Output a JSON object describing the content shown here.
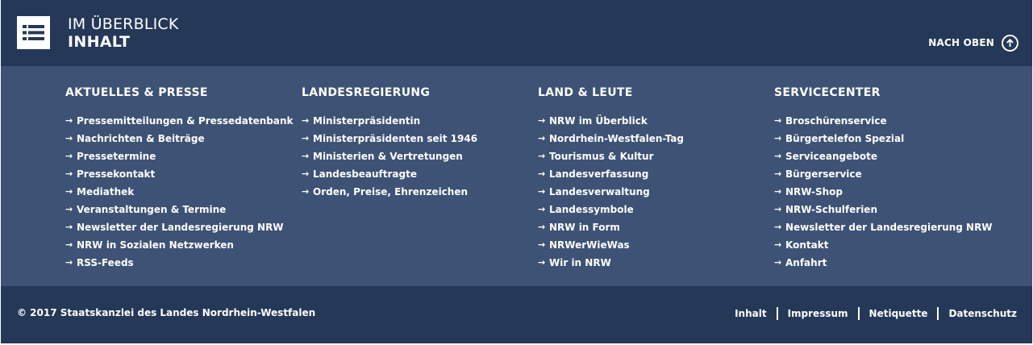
{
  "header": {
    "title_line1": "IM ÜBERBLICK",
    "title_line2": "INHALT",
    "to_top_label": "NACH OBEN",
    "menu_icon": "list-icon",
    "to_top_icon": "arrow-up-circle-icon"
  },
  "columns": [
    {
      "heading": "AKTUELLES & PRESSE",
      "links": [
        "Pressemitteilungen & Pressedatenbank",
        "Nachrichten & Beiträge",
        "Pressetermine",
        "Pressekontakt",
        "Mediathek",
        "Veranstaltungen & Termine",
        "Newsletter der Landesregierung NRW",
        "NRW in Sozialen Netzwerken",
        "RSS-Feeds"
      ]
    },
    {
      "heading": "LANDESREGIERUNG",
      "links": [
        "Ministerpräsidentin",
        "Ministerpräsidenten seit 1946",
        "Ministerien & Vertretungen",
        "Landesbeauftragte",
        "Orden, Preise, Ehrenzeichen"
      ]
    },
    {
      "heading": "LAND & LEUTE",
      "links": [
        "NRW im Überblick",
        "Nordrhein-Westfalen-Tag",
        "Tourismus & Kultur",
        "Landesverfassung",
        "Landesverwaltung",
        "Landessymbole",
        "NRW in Form",
        "NRWerWieWas",
        "Wir in NRW"
      ]
    },
    {
      "heading": "SERVICECENTER",
      "links": [
        "Broschürenservice",
        "Bürgertelefon Spezial",
        "Serviceangebote",
        "Bürgerservice",
        "NRW-Shop",
        "NRW-Schulferien",
        "Newsletter der Landesregierung NRW",
        "Kontakt",
        "Anfahrt"
      ]
    }
  ],
  "footer": {
    "copyright": "© 2017 Staatskanzlei des Landes Nordrhein-Westfalen",
    "links": [
      "Inhalt",
      "Impressum",
      "Netiquette",
      "Datenschutz"
    ]
  },
  "colors": {
    "header_bg": "#253857",
    "panel_bg": "#3d5274",
    "text": "#ffffff"
  }
}
